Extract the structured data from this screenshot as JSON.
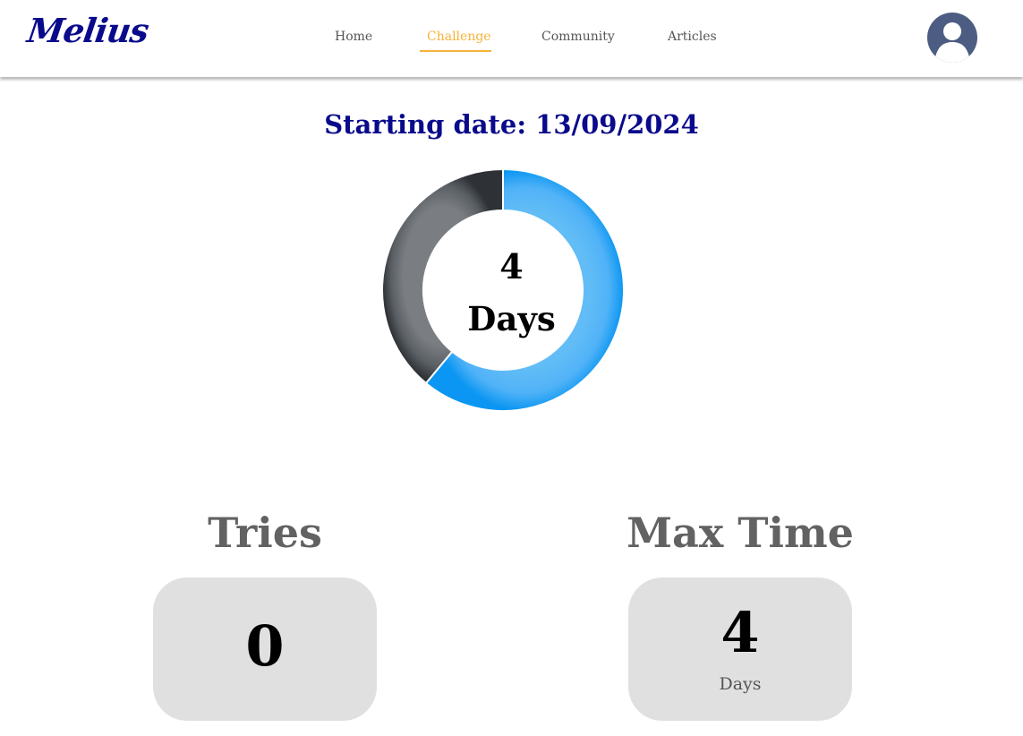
{
  "navbar": {
    "logo": "Melius",
    "links": [
      {
        "label": "Home",
        "active": false
      },
      {
        "label": "Challenge",
        "active": true
      },
      {
        "label": "Community",
        "active": false
      },
      {
        "label": "Articles",
        "active": false
      }
    ],
    "active_color": "#f5b339",
    "avatar_icon": "user-avatar-icon"
  },
  "challenge": {
    "starting_date": "Starting date: 13/09/2024",
    "progress": {
      "value": "4",
      "unit": "Days",
      "completed_fraction": 0.61,
      "completed_color": "#46adf5",
      "remaining_color": "#555b62"
    }
  },
  "stats": {
    "tries": {
      "title": "Tries",
      "value": "0"
    },
    "max_time": {
      "title": "Max Time",
      "value": "4",
      "unit": "Days"
    }
  },
  "colors": {
    "brand": "#0a0a8c",
    "stat_title": "#626262",
    "stat_box": "#e0e0e0"
  }
}
